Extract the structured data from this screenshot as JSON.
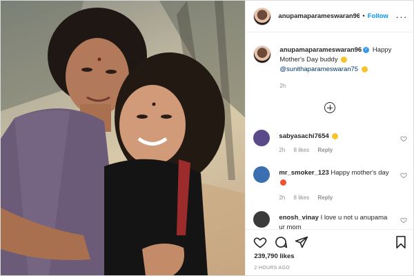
{
  "post": {
    "username": "anupamaparameswaran96",
    "header_username": "anupamaparameswaran96",
    "follow_label": "Follow",
    "caption_text": "Happy Mother's Day buddy",
    "caption_mention": "@sunithaparameswaran75",
    "caption_time": "2h",
    "likes": "239,790 likes",
    "posted_ago": "2 HOURS AGO"
  },
  "comments": [
    {
      "username": "sabyasachi7654",
      "text": "",
      "time": "2h",
      "likes": "8 likes",
      "reply": "Reply",
      "avatar_color": "#5b4a8a"
    },
    {
      "username": "mr_smoker_123",
      "text": "Happy mother's day",
      "time": "2h",
      "likes": "8 likes",
      "reply": "Reply",
      "avatar_color": "#3b6fb0"
    },
    {
      "username": "enosh_vinay",
      "text": "I love u not u anupama ur mom",
      "avatar_color": "#3a3a3a"
    }
  ],
  "icons": {
    "more": "more-icon",
    "like": "heart-icon",
    "comment": "comment-icon",
    "share": "share-icon",
    "save": "bookmark-icon",
    "load_more": "plus-circle-icon"
  },
  "colors": {
    "accent": "#0095f6",
    "text": "#262626",
    "muted": "#8e8e8e",
    "border": "#dbdbdb"
  }
}
